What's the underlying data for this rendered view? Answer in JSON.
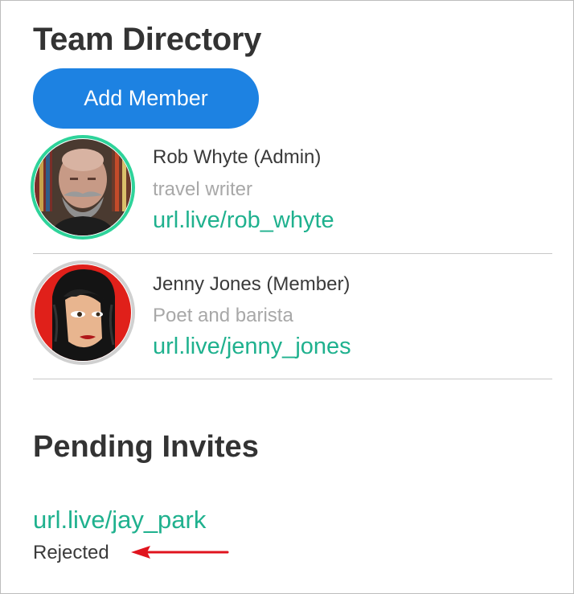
{
  "directory": {
    "title": "Team Directory",
    "add_button_label": "Add Member"
  },
  "members": [
    {
      "name": "Rob Whyte (Admin)",
      "bio": "travel writer",
      "link": "url.live/rob_whyte",
      "avatar_ring_color": "#2ed39a"
    },
    {
      "name": "Jenny Jones (Member)",
      "bio": "Poet and barista",
      "link": "url.live/jenny_jones",
      "avatar_ring_color": "#d0d0d0"
    }
  ],
  "pending": {
    "title": "Pending Invites",
    "invites": [
      {
        "link": "url.live/jay_park",
        "status": "Rejected"
      }
    ]
  },
  "colors": {
    "accent_button": "#1d82e2",
    "link": "#1fb18e",
    "annotation_arrow": "#e0141e"
  }
}
